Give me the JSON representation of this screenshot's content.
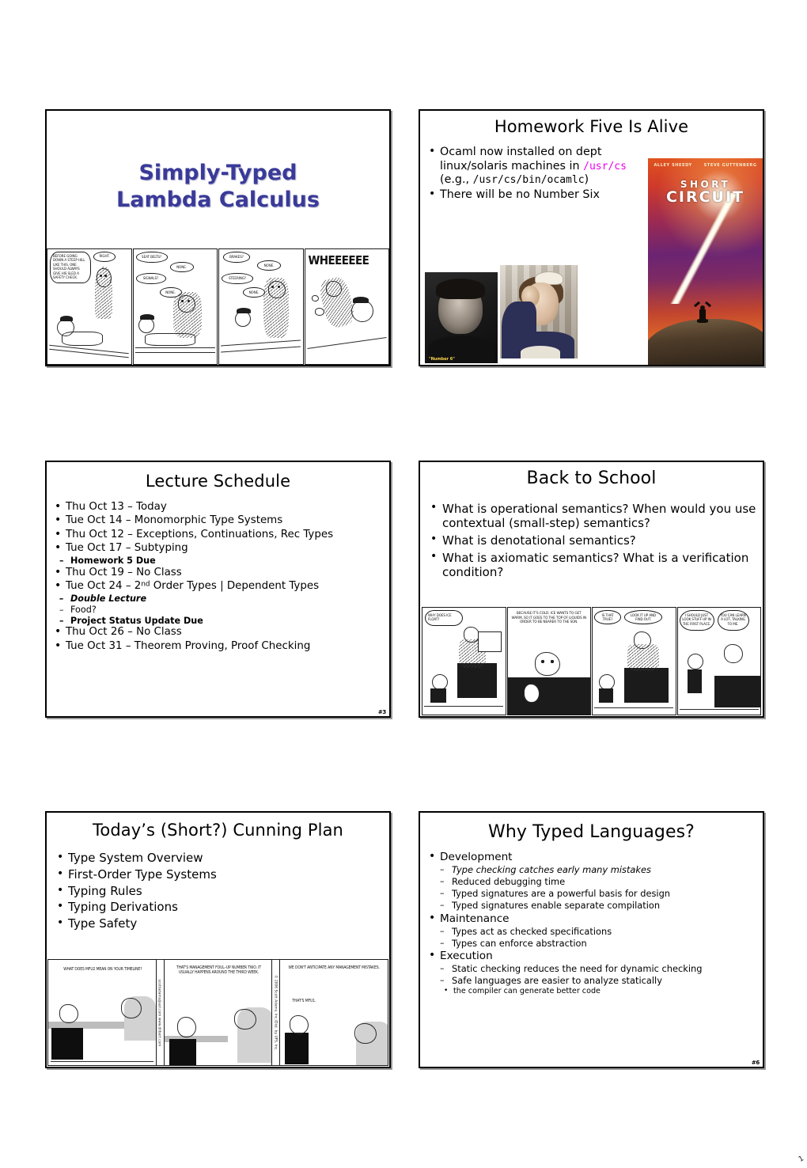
{
  "document": {
    "kind": "lecture-slide-handout",
    "slides_per_row": 2,
    "slide_count": 6
  },
  "slide1": {
    "title_line1": "Simply-Typed",
    "title_line2": "Lambda Calculus",
    "title_color": "#3a3a99",
    "comic": {
      "name": "calvin-and-hobbes-sled-safety-check",
      "panels": [
        {
          "bubbles": [
            "BEFORE GOING DOWN A STEEP HILL LIKE THIS, ONE SHOULD ALWAYS GIVE HIS SLED A SAFETY CHECK.",
            "RIGHT."
          ]
        },
        {
          "bubbles": [
            "SEAT BELTS?",
            "NONE.",
            "SIGNALS?",
            "NONE."
          ]
        },
        {
          "bubbles": [
            "BRAKES?",
            "NONE.",
            "STEERING?",
            "NONE."
          ]
        },
        {
          "bubbles": [
            "WHEEEEEE"
          ]
        }
      ]
    }
  },
  "slide2": {
    "title": "Homework Five Is Alive",
    "bullets": [
      {
        "segments": [
          {
            "text": "Ocaml now installed on dept linux/solaris machines in ",
            "style": "plain"
          },
          {
            "text": "/usr/cs",
            "style": "mono-magenta"
          },
          {
            "text": " (e.g., ",
            "style": "plain"
          },
          {
            "text": "/usr/cs/bin/ocamlc",
            "style": "mono"
          },
          {
            "text": ")",
            "style": "plain"
          }
        ]
      },
      {
        "segments": [
          {
            "text": "There will be no Number Six",
            "style": "plain"
          }
        ]
      }
    ],
    "poster": {
      "name": "short-circuit-movie-poster",
      "credit_left": "ALLEY SHEEDY",
      "credit_right": "STEVE GUTTENBERG",
      "title_line1": "SHORT",
      "title_line2": "CIRCUIT"
    },
    "photo_left": {
      "name": "the-prisoner-number-six-photo",
      "caption": "\"Number 6\""
    },
    "photo_right": {
      "name": "woman-ok-gesture-photo"
    },
    "colors": {
      "path_magenta": "#ee00ee"
    }
  },
  "slide3": {
    "title": "Lecture Schedule",
    "page_number": "#3",
    "items": [
      {
        "level": 1,
        "text": "Thu Oct 13 – Today",
        "color": "black",
        "bold": false,
        "italic": false
      },
      {
        "level": 1,
        "text": "Tue Oct 14 – Monomorphic Type Systems",
        "color": "black",
        "bold": false,
        "italic": false
      },
      {
        "level": 1,
        "text": "Thu Oct 12 – Exceptions, Continuations, Rec Types",
        "color": "black",
        "bold": false,
        "italic": false
      },
      {
        "level": 1,
        "text": "Tue Oct 17 – Subtyping",
        "color": "black",
        "bold": false,
        "italic": false
      },
      {
        "level": 2,
        "text": "Homework 5 Due",
        "color": "red",
        "bold": true,
        "italic": false
      },
      {
        "level": 1,
        "text": "Thu Oct 19 – No Class",
        "color": "green",
        "bold": false,
        "italic": false
      },
      {
        "level": 1,
        "text": "Tue Oct 24 – 2nd Order Types | Dependent Types",
        "color": "magenta",
        "bold": false,
        "italic": false,
        "superscript": "nd"
      },
      {
        "level": 2,
        "text": "Double Lecture",
        "color": "red",
        "bold": true,
        "italic": true
      },
      {
        "level": 2,
        "text": "Food?",
        "color": "magenta",
        "bold": false,
        "italic": false
      },
      {
        "level": 2,
        "text": "Project Status Update Due",
        "color": "red",
        "bold": true,
        "italic": false
      },
      {
        "level": 1,
        "text": "Thu Oct 26 – No Class",
        "color": "green",
        "bold": false,
        "italic": false
      },
      {
        "level": 1,
        "text": "Tue Oct 31 – Theorem Proving, Proof Checking",
        "color": "black",
        "bold": false,
        "italic": false
      }
    ]
  },
  "slide4": {
    "title": "Back to School",
    "bullets": [
      "What is operational semantics? When would you use contextual (small-step) semantics?",
      "What is denotational semantics?",
      "What is axiomatic semantics? What is a verification condition?"
    ],
    "comic": {
      "name": "calvin-and-hobbes-why-does-ice-float",
      "panels": [
        {
          "bubbles": [
            "WHY DOES ICE FLOAT?"
          ]
        },
        {
          "bubbles": [
            "BECAUSE IT'S COLD. ICE WANTS TO GET WARM, SO IT GOES TO THE TOP OF LIQUIDS IN ORDER TO BE NEARER TO THE SUN."
          ]
        },
        {
          "bubbles": [
            "IS THAT TRUE?",
            "LOOK IT UP AND FIND OUT."
          ]
        },
        {
          "bubbles": [
            "I SHOULD JUST LOOK STUFF UP IN THE FIRST PLACE.",
            "YOU CAN LEARN A LOT, TALKING TO ME."
          ]
        }
      ]
    }
  },
  "slide5": {
    "title": "Today’s (Short?) Cunning Plan",
    "bullets": [
      {
        "text": "Type System Overview",
        "color": "black"
      },
      {
        "text": "First-Order Type Systems",
        "color": "black"
      },
      {
        "text": "Typing Rules",
        "color": "green"
      },
      {
        "text": "Typing Derivations",
        "color": "black"
      },
      {
        "text": "Type Safety",
        "color": "green"
      }
    ],
    "comic": {
      "name": "dilbert-management-foul-up",
      "sidebar_left": "scottadams@aol.com   www.dilbert.com",
      "sidebar_right": "© 2006 Scott Adams, Inc./Dist. by UFS, Inc.",
      "panels": [
        {
          "bubbles": [
            "WHAT DOES MFU2 MEAN ON YOUR TIMELINE?"
          ]
        },
        {
          "bubbles": [
            "THAT'S MANAGEMENT FOUL–UP NUMBER TWO. IT USUALLY HAPPENS AROUND THE THIRD WEEK."
          ]
        },
        {
          "bubbles": [
            "WE DON'T ANTICIPATE ANY MANAGEMENT MISTAKES.",
            "THAT'S MFU1."
          ]
        }
      ]
    }
  },
  "slide6": {
    "title": "Why Typed Languages?",
    "page_number": "#6",
    "items": [
      {
        "level": 1,
        "text": "Development",
        "color": "black",
        "italic": false
      },
      {
        "level": 2,
        "text": "Type checking catches early many mistakes",
        "color": "green",
        "italic": true
      },
      {
        "level": 2,
        "text": "Reduced debugging time",
        "color": "black",
        "italic": false
      },
      {
        "level": 2,
        "text": "Typed signatures are a powerful basis for design",
        "color": "black",
        "italic": false
      },
      {
        "level": 2,
        "text": "Typed signatures enable separate compilation",
        "color": "black",
        "italic": false
      },
      {
        "level": 1,
        "text": "Maintenance",
        "color": "black",
        "italic": false
      },
      {
        "level": 2,
        "text": "Types act as checked specifications",
        "color": "black",
        "italic": false
      },
      {
        "level": 2,
        "text": "Types can enforce abstraction",
        "color": "black",
        "italic": false
      },
      {
        "level": 1,
        "text": "Execution",
        "color": "black",
        "italic": false
      },
      {
        "level": 2,
        "text": "Static checking reduces the need for dynamic checking",
        "color": "black",
        "italic": false
      },
      {
        "level": 2,
        "text": "Safe languages are easier to analyze statically",
        "color": "green",
        "italic": false
      },
      {
        "level": 3,
        "text": "the compiler can generate better code",
        "color": "black",
        "italic": false
      }
    ]
  },
  "footer": {
    "corner_mark": "1"
  }
}
